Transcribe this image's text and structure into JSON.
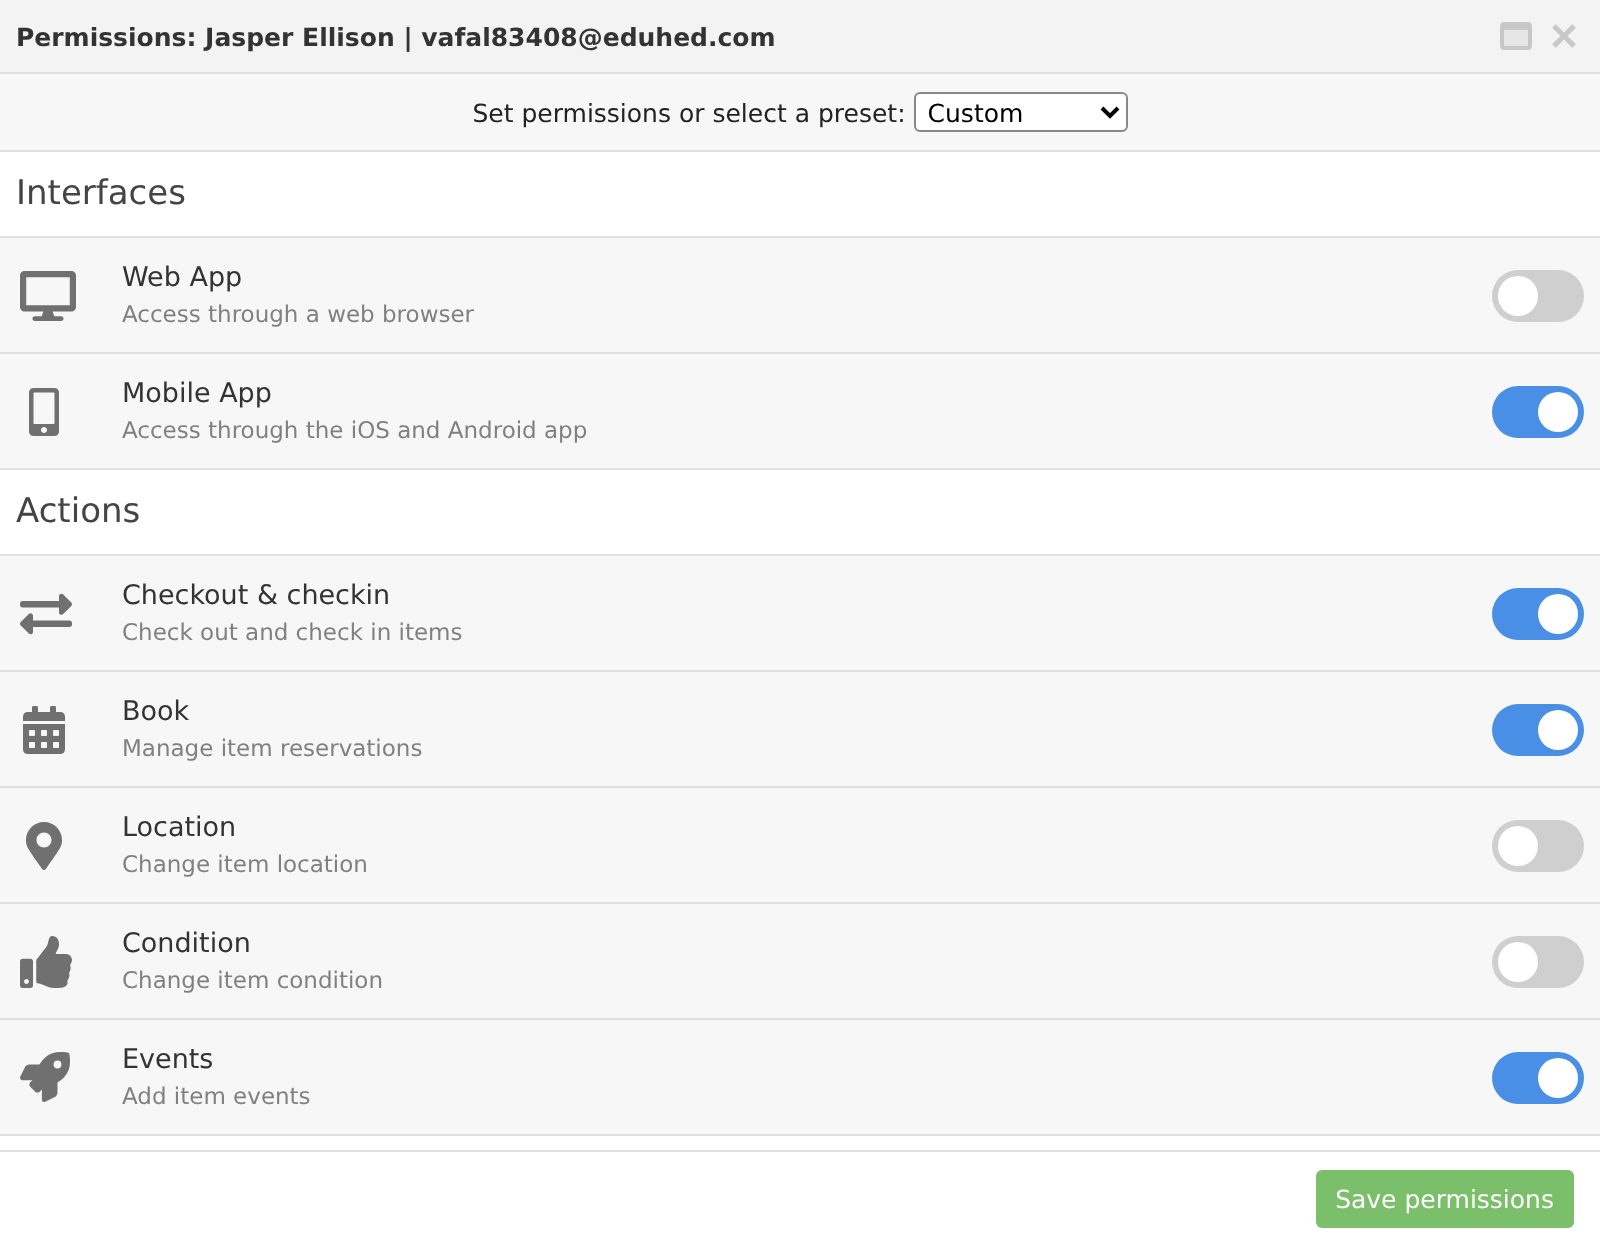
{
  "window": {
    "title": "Permissions: Jasper Ellison | vafal83408@eduhed.com"
  },
  "preset": {
    "label": "Set permissions or select a preset:",
    "value": "Custom"
  },
  "sections": [
    {
      "title": "Interfaces",
      "items": [
        {
          "kind": "desktop",
          "name": "Web App",
          "description": "Access through a web browser",
          "on": false
        },
        {
          "kind": "mobile",
          "name": "Mobile App",
          "description": "Access through the iOS and Android app",
          "on": true
        }
      ]
    },
    {
      "title": "Actions",
      "items": [
        {
          "kind": "transfer",
          "name": "Checkout & checkin",
          "description": "Check out and check in items",
          "on": true
        },
        {
          "kind": "booking",
          "name": "Book",
          "description": "Manage item reservations",
          "on": true
        },
        {
          "kind": "location",
          "name": "Location",
          "description": "Change item location",
          "on": false
        },
        {
          "kind": "condition",
          "name": "Condition",
          "description": "Change item condition",
          "on": false
        },
        {
          "kind": "events",
          "name": "Events",
          "description": "Add item events",
          "on": true
        }
      ]
    }
  ],
  "save_button": "Save permissions"
}
